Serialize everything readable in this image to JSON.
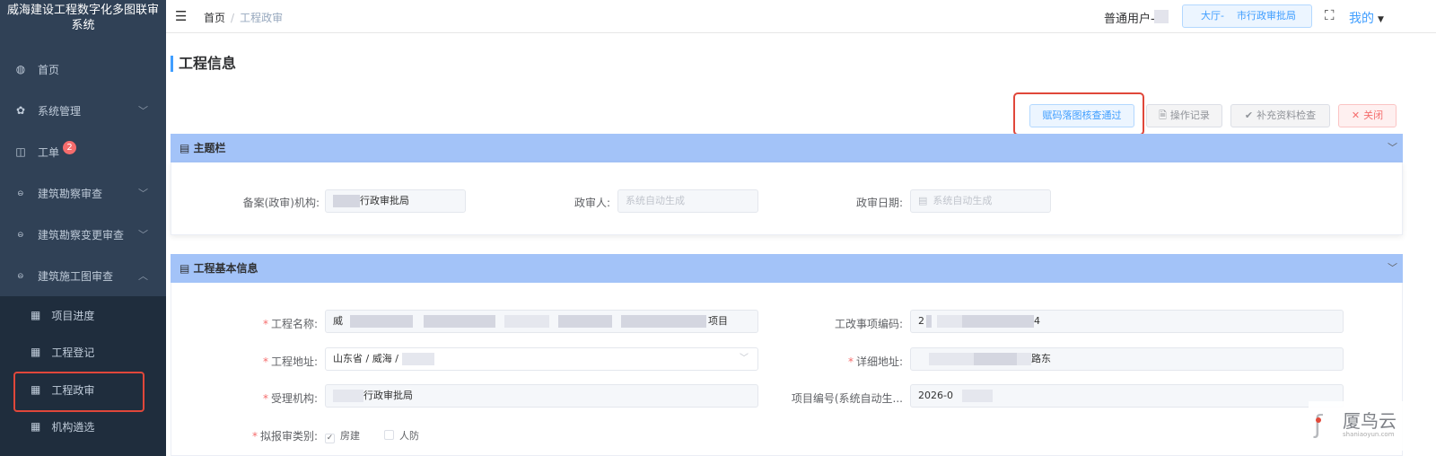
{
  "sidebar": {
    "title": "威海建设工程数字化多图联审系统",
    "items": [
      {
        "label": "首页",
        "icon": "dashboard-icon"
      },
      {
        "label": "系统管理",
        "icon": "gear-icon"
      },
      {
        "label": "工单",
        "icon": "book-icon",
        "badge": "2"
      },
      {
        "label": "建筑勘察审查",
        "icon": "document-icon"
      },
      {
        "label": "建筑勘察变更审查",
        "icon": "document-icon"
      },
      {
        "label": "建筑施工图审查",
        "icon": "document-icon"
      }
    ],
    "subitems": [
      {
        "label": "项目进度",
        "icon": "table-icon"
      },
      {
        "label": "工程登记",
        "icon": "table-icon"
      },
      {
        "label": "工程政审",
        "icon": "table-icon"
      },
      {
        "label": "机构遴选",
        "icon": "table-icon"
      }
    ]
  },
  "header": {
    "breadcrumb_home": "首页",
    "breadcrumb_sep": "/",
    "breadcrumb_current": "工程政审",
    "user_label": "普通用户-",
    "role_prefix": "大厅-",
    "role_suffix": "市行政审批局",
    "mine_label": "我的"
  },
  "page": {
    "title": "工程信息",
    "actions": {
      "pass": "赋码落图核查通过",
      "log": "操作记录",
      "check": "补充资料检查",
      "close": "关闭"
    }
  },
  "topic_section": {
    "title": "主题栏",
    "org_label": "备案(政审)机构:",
    "org_value": "行政审批局",
    "reviewer_label": "政审人:",
    "reviewer_placeholder": "系统自动生成",
    "date_label": "政审日期:",
    "date_placeholder": "系统自动生成"
  },
  "basic_section": {
    "title": "工程基本信息",
    "name_label": "工程名称:",
    "name_value_first": "威",
    "name_value_suffix": "项目",
    "code_label": "工改事项编码:",
    "code_value_first": "2",
    "code_value_last": "4",
    "address_label": "工程地址:",
    "address_value": "山东省 / 威海 /",
    "detail_label": "详细地址:",
    "detail_value_suffix": "路东",
    "accept_label": "受理机构:",
    "accept_value": "行政审批局",
    "projno_label": "项目编号(系统自动生...",
    "projno_value": "2026-0",
    "category_label": "拟报审类别:",
    "category_options": [
      {
        "label": "房建",
        "checked": true
      },
      {
        "label": "人防",
        "checked": false
      }
    ]
  },
  "watermark": {
    "name": "厦鸟云",
    "url": "shaniaoyun.com"
  },
  "colors": {
    "sidebar_bg": "#304156",
    "section_header": "#a3c3f8",
    "primary": "#409eff",
    "danger": "#f56c6c",
    "highlight_box": "#e0473a"
  }
}
